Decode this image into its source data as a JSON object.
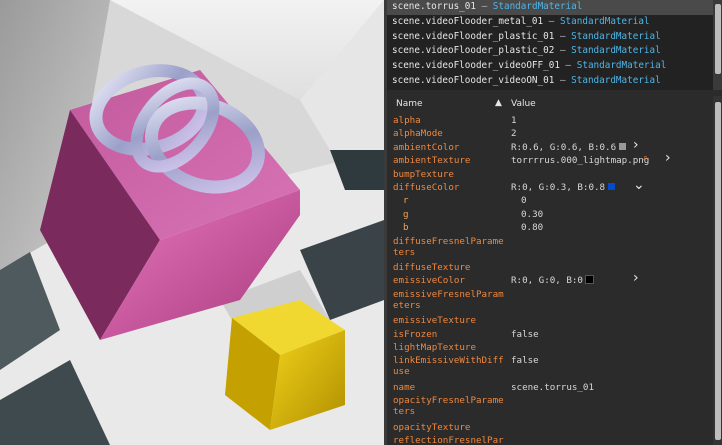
{
  "scene_list": {
    "items": [
      {
        "object": "scene.torrus_01",
        "material": "StandardMaterial",
        "selected": true
      },
      {
        "object": "scene.videoFlooder_metal_01",
        "material": "StandardMaterial",
        "selected": false
      },
      {
        "object": "scene.videoFlooder_plastic_01",
        "material": "StandardMaterial",
        "selected": false
      },
      {
        "object": "scene.videoFlooder_plastic_02",
        "material": "StandardMaterial",
        "selected": false
      },
      {
        "object": "scene.videoFlooder_videoOFF_01",
        "material": "StandardMaterial",
        "selected": false
      },
      {
        "object": "scene.videoFlooder_videoON_01",
        "material": "StandardMaterial",
        "selected": false
      }
    ],
    "separator": "–"
  },
  "header": {
    "name_label": "Name",
    "sort_icon": "sort-up-icon",
    "value_label": "Value"
  },
  "properties": [
    {
      "name": "alpha",
      "value": "1"
    },
    {
      "name": "alphaMode",
      "value": "2"
    },
    {
      "name": "ambientColor",
      "value": "R:0.6, G:0.6, B:0.6",
      "swatch": "#999999",
      "action_icon": "chevron-right-icon"
    },
    {
      "name": "ambientTexture",
      "value": "torrrrus.000_lightmap.png",
      "extra_icon": "search-icon",
      "action_icon": "chevron-right-icon"
    },
    {
      "name": "bumpTexture",
      "value": ""
    },
    {
      "name": "diffuseColor",
      "value": "R:0, G:0.3, B:0.8",
      "swatch": "#004ccc",
      "action_icon": "chevron-down-icon"
    },
    {
      "name": "r",
      "value": "0",
      "sub": true
    },
    {
      "name": "g",
      "value": "0.30",
      "sub": true
    },
    {
      "name": "b",
      "value": "0.80",
      "sub": true
    },
    {
      "name": "diffuseFresnelParameters",
      "value": "",
      "wrap": true
    },
    {
      "name": "diffuseTexture",
      "value": ""
    },
    {
      "name": "emissiveColor",
      "value": "R:0, G:0, B:0",
      "swatch": "#000000",
      "action_icon": "chevron-right-icon"
    },
    {
      "name": "emissiveFresnelParameters",
      "value": "",
      "wrap": true
    },
    {
      "name": "emissiveTexture",
      "value": ""
    },
    {
      "name": "isFrozen",
      "value": "false"
    },
    {
      "name": "lightMapTexture",
      "value": ""
    },
    {
      "name": "linkEmissiveWithDiffuse",
      "value": "false",
      "wrap": true
    },
    {
      "name": "name",
      "value": "scene.torrus_01"
    },
    {
      "name": "opacityFresnelParameters",
      "value": "",
      "wrap": true
    },
    {
      "name": "opacityTexture",
      "value": ""
    },
    {
      "name": "reflectionFresnelParameters",
      "value": "",
      "wrap": true
    }
  ],
  "colors": {
    "prop_name": "#f0883e",
    "material_type": "#4fb6e8",
    "pink_cube": "#d0529c",
    "yellow_cube": "#e8c000"
  }
}
